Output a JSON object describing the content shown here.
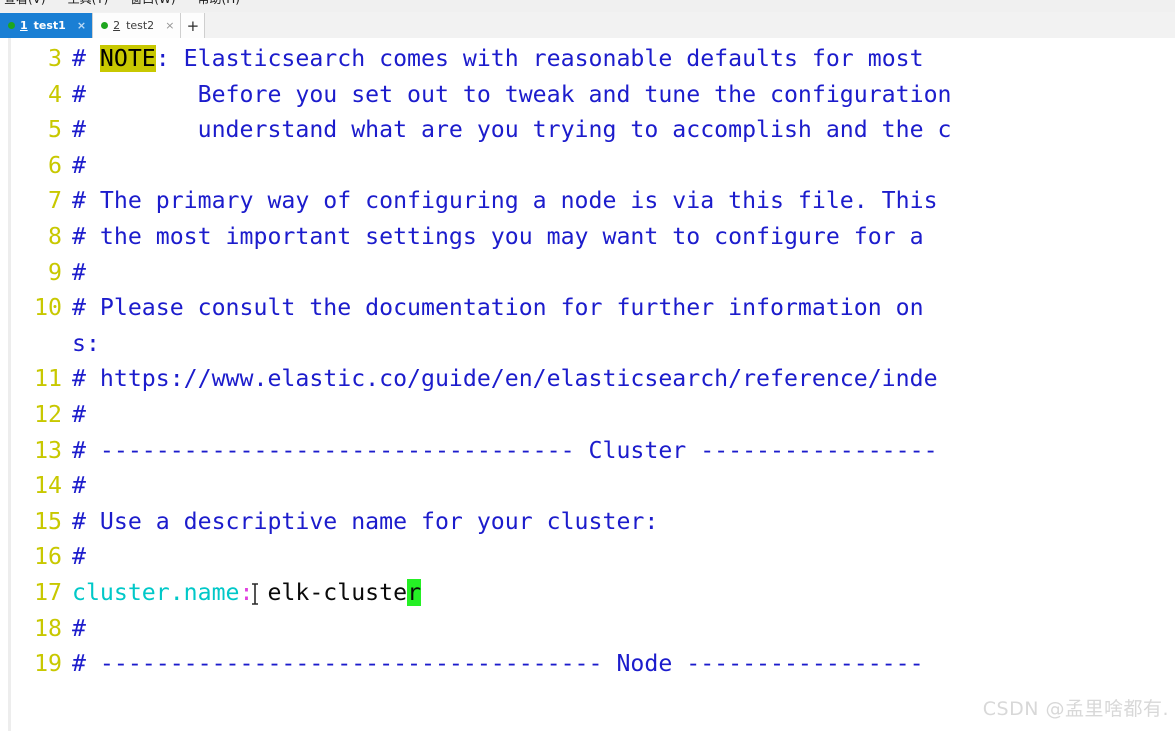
{
  "menu": {
    "items": [
      "查看(V)",
      "工具(T)",
      "窗口(W)",
      "帮助(H)"
    ]
  },
  "tabs": {
    "items": [
      {
        "number": "1",
        "label": "test1",
        "state": "active",
        "close_glyph": "×",
        "status_color": "#1ea61e"
      },
      {
        "number": "2",
        "label": "test2",
        "state": "inactive",
        "close_glyph": "×",
        "status_color": "#1ea61e"
      }
    ],
    "add_label": "+"
  },
  "editor": {
    "lines": [
      {
        "num": "3",
        "segments": [
          {
            "text": "# ",
            "style": "cm"
          },
          {
            "text": "NOTE",
            "style": "note-hl"
          },
          {
            "text": ": Elasticsearch comes with reasonable defaults for most",
            "style": "cm"
          }
        ]
      },
      {
        "num": "4",
        "segments": [
          {
            "text": "#        Before you set out to tweak and tune the configuration",
            "style": "cm"
          }
        ]
      },
      {
        "num": "5",
        "segments": [
          {
            "text": "#        understand what are you trying to accomplish and the c",
            "style": "cm"
          }
        ]
      },
      {
        "num": "6",
        "segments": [
          {
            "text": "#",
            "style": "cm"
          }
        ]
      },
      {
        "num": "7",
        "segments": [
          {
            "text": "# The primary way of configuring a node is via this file. This",
            "style": "cm"
          }
        ]
      },
      {
        "num": "8",
        "segments": [
          {
            "text": "# the most important settings you may want to configure for a",
            "style": "cm"
          }
        ]
      },
      {
        "num": "9",
        "segments": [
          {
            "text": "#",
            "style": "cm"
          }
        ]
      },
      {
        "num": "10",
        "segments": [
          {
            "text": "# Please consult the documentation for further information on",
            "style": "cm"
          }
        ]
      },
      {
        "num": "",
        "segments": [
          {
            "text": "s:",
            "style": "cm"
          }
        ]
      },
      {
        "num": "11",
        "segments": [
          {
            "text": "# https://www.elastic.co/guide/en/elasticsearch/reference/inde",
            "style": "cm"
          }
        ]
      },
      {
        "num": "12",
        "segments": [
          {
            "text": "#",
            "style": "cm"
          }
        ]
      },
      {
        "num": "13",
        "segments": [
          {
            "text": "# ---------------------------------- Cluster -----------------",
            "style": "cm"
          }
        ]
      },
      {
        "num": "14",
        "segments": [
          {
            "text": "#",
            "style": "cm"
          }
        ]
      },
      {
        "num": "15",
        "segments": [
          {
            "text": "# Use a descriptive name for your cluster:",
            "style": "cm"
          }
        ]
      },
      {
        "num": "16",
        "segments": [
          {
            "text": "#",
            "style": "cm"
          }
        ]
      },
      {
        "num": "17",
        "segments": [
          {
            "text": "cluster.name",
            "style": "key"
          },
          {
            "text": ":",
            "style": "colon"
          },
          {
            "text": "ibeam",
            "style": "ibeam"
          },
          {
            "text": " elk-cluste",
            "style": "val"
          },
          {
            "text": "r",
            "style": "cursor-block"
          }
        ]
      },
      {
        "num": "18",
        "segments": [
          {
            "text": "#",
            "style": "cm"
          }
        ]
      },
      {
        "num": "19",
        "segments": [
          {
            "text": "# ------------------------------------ Node -----------------",
            "style": "cm"
          }
        ]
      }
    ],
    "colors": {
      "line_number": "#c8c800",
      "comment": "#1c1ccc",
      "key": "#00c8c8",
      "colon": "#e040e0",
      "value": "#0a0a0a",
      "note_highlight_bg": "#c8c800",
      "cursor_bg": "#25ef25",
      "background": "#ffffff"
    }
  },
  "watermark": {
    "text": "CSDN @孟里啥都有."
  }
}
